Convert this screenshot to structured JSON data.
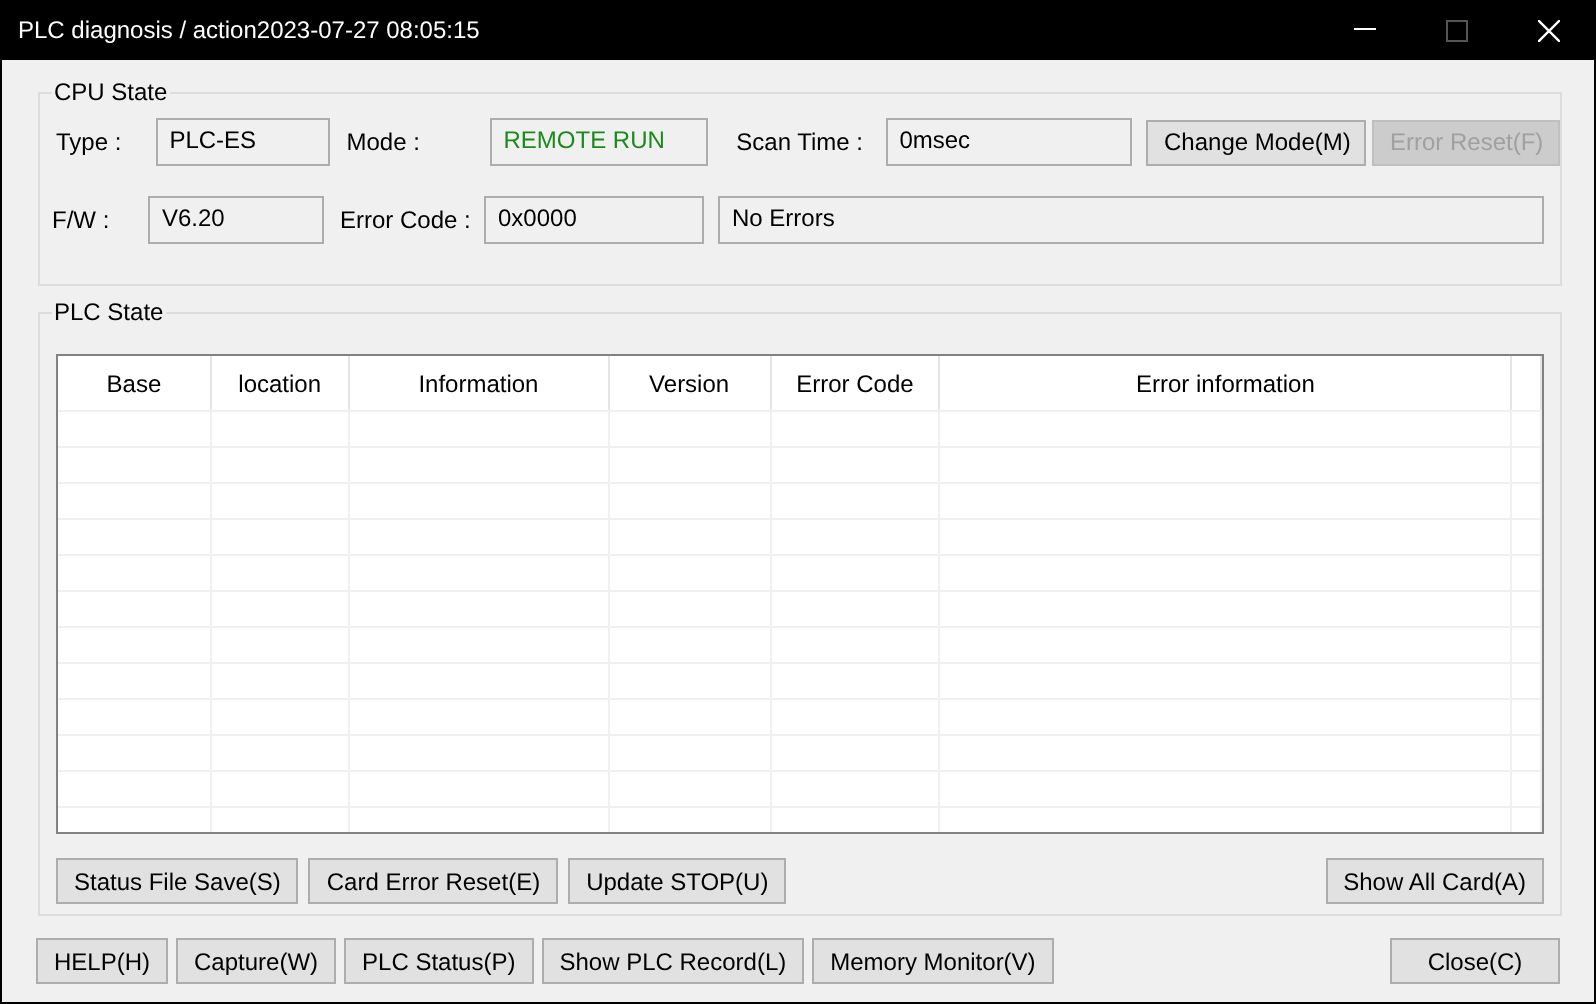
{
  "window": {
    "title": "PLC diagnosis / action2023-07-27 08:05:15"
  },
  "cpu_state": {
    "title": "CPU State",
    "row_1": [
      {
        "kind": "field",
        "label": "Type :",
        "value": "PLC-ES"
      },
      {
        "kind": "status",
        "label": "Mode :",
        "value": "REMOTE RUN"
      },
      {
        "kind": "field",
        "label": "Scan Time :",
        "value": "0msec"
      }
    ],
    "row_1_buttons": [
      {
        "label": "Change Mode(M)",
        "disabled": false
      },
      {
        "label": "Error Reset(F)",
        "disabled": true
      }
    ],
    "row_2": [
      {
        "kind": "field",
        "label": "F/W :",
        "value": "V6.20"
      },
      {
        "kind": "field",
        "label": "Error Code :",
        "value": "0x0000"
      },
      {
        "kind": "wide",
        "value": "No Errors"
      }
    ]
  },
  "plc_state": {
    "title": "PLC State",
    "table": {
      "columns": [
        "Base",
        "location",
        "Information",
        "Version",
        "Error Code",
        "Error information"
      ]
    },
    "buttons_left": [
      {
        "label": "Status File Save(S)",
        "disabled": false
      },
      {
        "label": "Card Error Reset(E)",
        "disabled": false
      },
      {
        "label": "Update STOP(U)",
        "disabled": false
      }
    ],
    "buttons_right": [
      {
        "label": "Show All Card(A)",
        "disabled": false
      }
    ]
  },
  "footer_left": [
    {
      "label": "HELP(H)",
      "disabled": false
    },
    {
      "label": "Capture(W)",
      "disabled": false
    },
    {
      "label": "PLC Status(P)",
      "disabled": false
    },
    {
      "label": "Show PLC Record(L)",
      "disabled": false
    },
    {
      "label": "Memory Monitor(V)",
      "disabled": false
    }
  ],
  "footer_right": [
    {
      "label": "Close(C)",
      "disabled": false
    }
  ]
}
